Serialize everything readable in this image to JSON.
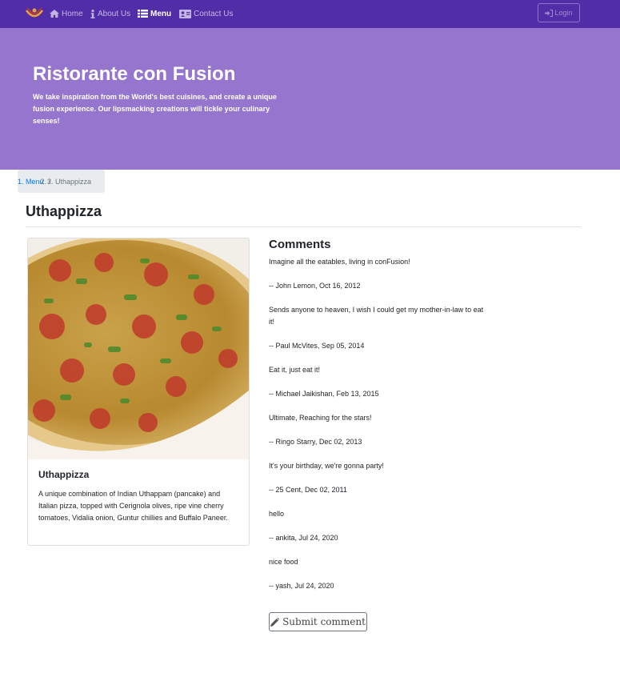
{
  "navbar": {
    "items": [
      {
        "label": "Home",
        "icon": "home-icon"
      },
      {
        "label": "About Us",
        "icon": "info-icon"
      },
      {
        "label": "Menu",
        "icon": "list-icon",
        "active": true
      },
      {
        "label": "Contact Us",
        "icon": "address-card-icon"
      }
    ],
    "login_label": "Login",
    "color": "#512da8"
  },
  "jumbotron": {
    "title": "Ristorante con Fusion",
    "text": "We take inspiration from the World's best cuisines, and create a unique fusion experience. Our lipsmacking creations will tickle your culinary senses!",
    "color": "#9575cd"
  },
  "breadcrumb": {
    "link": "Menu",
    "separator": "/",
    "active": "Uthappizza"
  },
  "page_title": "Uthappizza",
  "dish": {
    "name": "Uthappizza",
    "description": "A unique combination of Indian Uthappam (pancake) and Italian pizza, topped with Cerignola olives, ripe vine cherry tomatoes, Vidalia onion, Guntur chillies and Buffalo Paneer."
  },
  "comments": {
    "heading": "Comments",
    "items": [
      {
        "text": "Imagine all the eatables, living in conFusion!",
        "meta": "-- John Lemon, Oct 16, 2012"
      },
      {
        "text": "Sends anyone to heaven, I wish I could get my mother-in-law to eat it!",
        "meta": "-- Paul McVites, Sep 05, 2014"
      },
      {
        "text": "Eat it, just eat it!",
        "meta": "-- Michael Jaikishan, Feb 13, 2015"
      },
      {
        "text": "Ultimate, Reaching for the stars!",
        "meta": "-- Ringo Starry, Dec 02, 2013"
      },
      {
        "text": "It's your birthday, we're gonna party!",
        "meta": "-- 25 Cent, Dec 02, 2011"
      },
      {
        "text": "hello",
        "meta": "-- ankita, Jul 24, 2020"
      },
      {
        "text": "nice food",
        "meta": "-- yash, Jul 24, 2020"
      }
    ],
    "submit_label": "Submit comment"
  }
}
